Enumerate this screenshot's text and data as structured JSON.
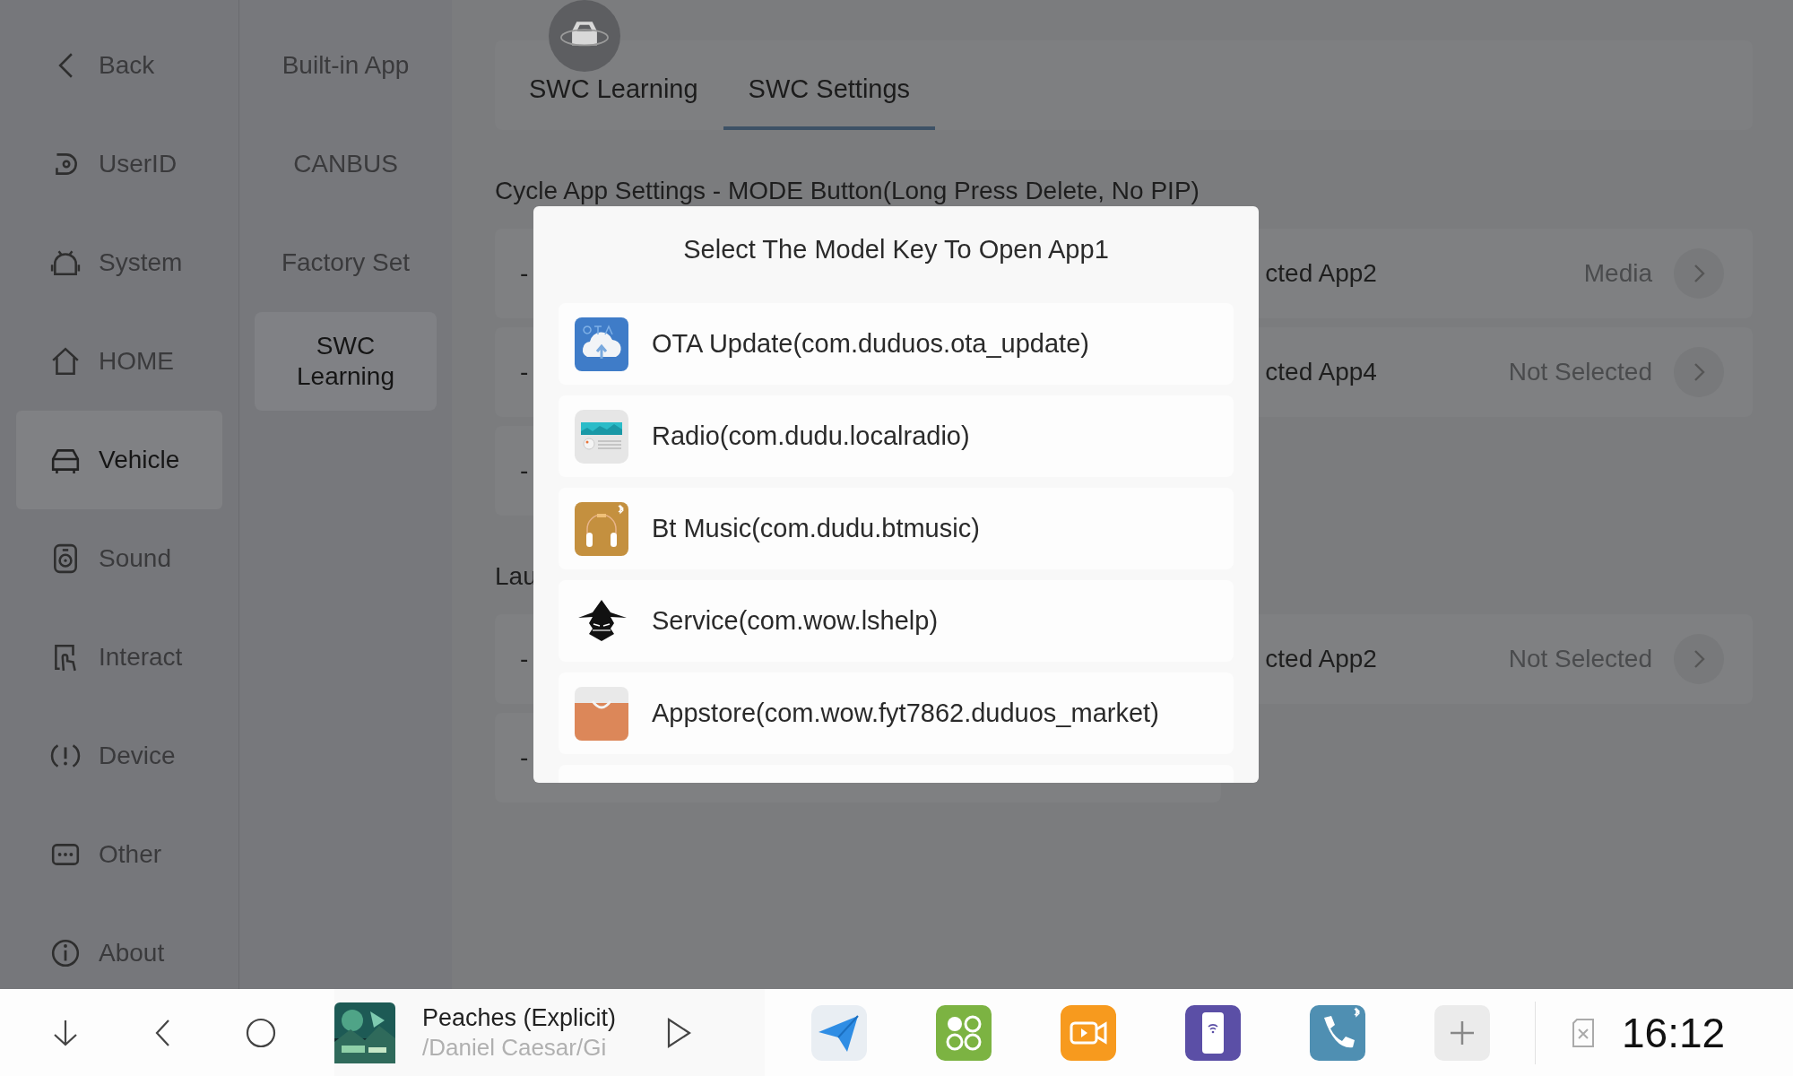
{
  "sidebar": {
    "items": [
      {
        "label": "Back",
        "selected": false
      },
      {
        "label": "UserID",
        "selected": false
      },
      {
        "label": "System",
        "selected": false
      },
      {
        "label": "HOME",
        "selected": false
      },
      {
        "label": "Vehicle",
        "selected": true
      },
      {
        "label": "Sound",
        "selected": false
      },
      {
        "label": "Interact",
        "selected": false
      },
      {
        "label": "Device",
        "selected": false
      },
      {
        "label": "Other",
        "selected": false
      },
      {
        "label": "About",
        "selected": false
      }
    ]
  },
  "submenu": {
    "items": [
      {
        "label": "Built-in App",
        "selected": false
      },
      {
        "label": "CANBUS",
        "selected": false
      },
      {
        "label": "Factory Set",
        "selected": false
      },
      {
        "label": "SWC\nLearning",
        "selected": true
      }
    ]
  },
  "tabs": [
    {
      "label": "SWC Learning",
      "selected": false
    },
    {
      "label": "SWC Settings",
      "selected": true
    }
  ],
  "sections": [
    {
      "title": "Cycle App Settings - MODE Button(Long Press Delete, No PIP)",
      "rows": [
        {
          "kind": "full",
          "label_start": "-",
          "label_end": "cted App2",
          "value": "Media"
        },
        {
          "kind": "full",
          "label_start": "-",
          "label_end": "cted App4",
          "value": "Not Selected"
        },
        {
          "kind": "short",
          "label_start": "-"
        }
      ]
    },
    {
      "title": "Lau",
      "rows": [
        {
          "kind": "full",
          "label_start": "-",
          "label_end": "cted App2",
          "value": "Not Selected"
        },
        {
          "kind": "short",
          "label_start": "-"
        }
      ]
    }
  ],
  "dialog": {
    "title": "Select The Model Key To Open App1",
    "items": [
      {
        "label": "OTA Update(com.duduos.ota_update)"
      },
      {
        "label": "Radio(com.dudu.localradio)"
      },
      {
        "label": "Bt Music(com.dudu.btmusic)"
      },
      {
        "label": "Service(com.wow.lshelp)"
      },
      {
        "label": "Appstore(com.wow.fyt7862.duduos_market)"
      }
    ]
  },
  "bottom_bar": {
    "media": {
      "title": "Peaches (Explicit)",
      "artist": "/Daniel Caesar/Gi"
    },
    "time": "16:12"
  }
}
